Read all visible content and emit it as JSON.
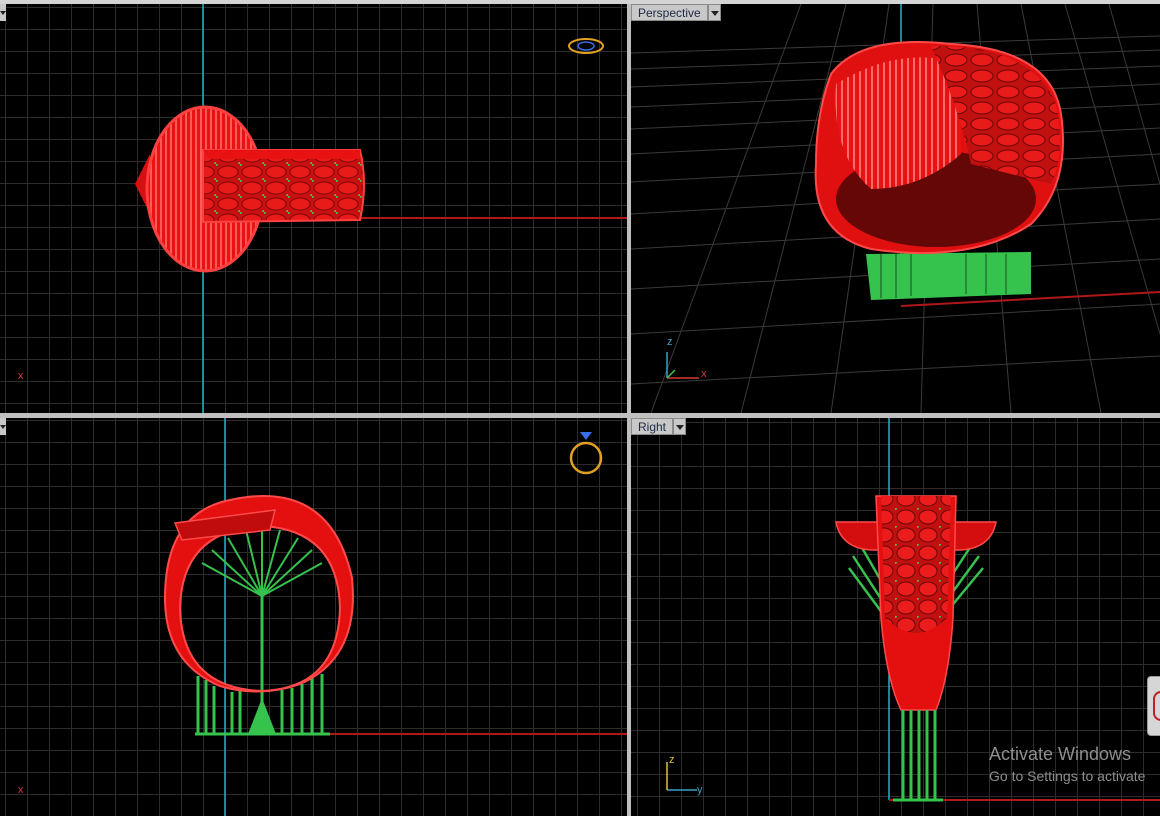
{
  "viewports": {
    "top": {
      "label": ""
    },
    "perspective": {
      "label": "Perspective"
    },
    "front": {
      "label": ""
    },
    "right": {
      "label": "Right"
    }
  },
  "axes": {
    "x": "x",
    "y": "y",
    "z": "z"
  },
  "watermark": {
    "line1": "Activate Windows",
    "line2": "Go to Settings to activate"
  },
  "colors": {
    "background": "#000000",
    "grid": "#2c2c2c",
    "ring": "#e81212",
    "supports": "#35c24d",
    "x_axis": "#b01818",
    "y_axis": "#1fb6c4",
    "gumball": "#e0a020"
  },
  "icons": {
    "gumball_top": "ring-gumball-icon",
    "gumball_front": "ring-gumball-icon",
    "dropdown": "chevron-down-icon"
  }
}
